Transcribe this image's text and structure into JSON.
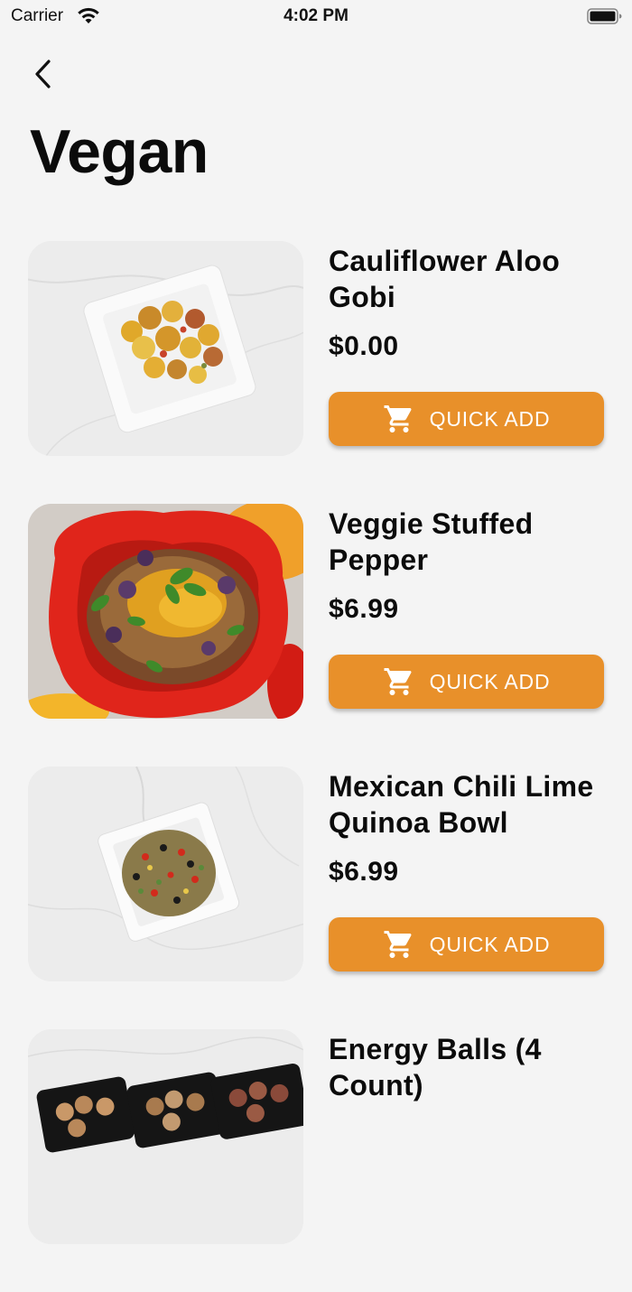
{
  "status_bar": {
    "carrier": "Carrier",
    "time": "4:02 PM"
  },
  "page": {
    "title": "Vegan",
    "back_icon": "chevron-left-icon"
  },
  "theme": {
    "accent": "#e8902a",
    "background": "#f4f4f4",
    "text": "#0b0b0b"
  },
  "products": [
    {
      "name": "Cauliflower Aloo Gobi",
      "price": "$0.00",
      "button_label": "QUICK ADD",
      "button_icon": "cart-icon",
      "image": "aloo-gobi-dish"
    },
    {
      "name": "Veggie Stuffed Pepper",
      "price": "$6.99",
      "button_label": "QUICK ADD",
      "button_icon": "cart-icon",
      "image": "stuffed-pepper-dish"
    },
    {
      "name": "Mexican Chili Lime Quinoa Bowl",
      "price": "$6.99",
      "button_label": "QUICK ADD",
      "button_icon": "cart-icon",
      "image": "quinoa-bowl-dish"
    },
    {
      "name": "Energy Balls (4 Count)",
      "image": "energy-balls-dish"
    }
  ]
}
